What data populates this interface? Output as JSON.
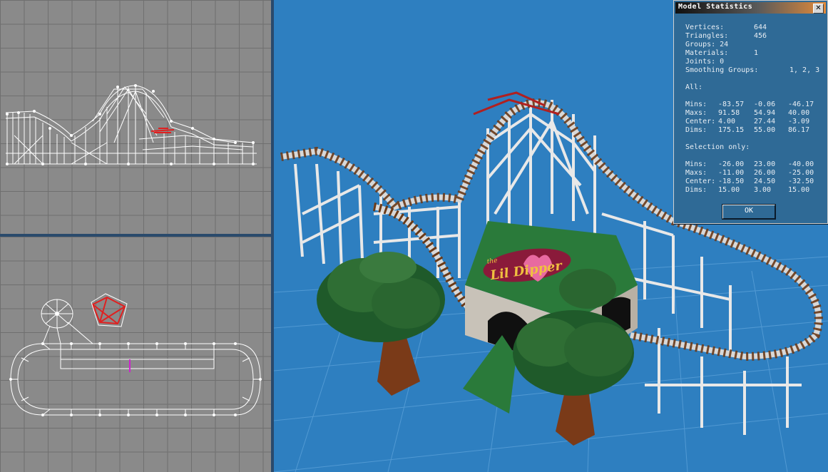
{
  "viewports": {
    "side": {
      "name": "side-view"
    },
    "top": {
      "name": "top-view"
    },
    "perspective": {
      "sign_text": "Lil Dipper",
      "sign_prefix": "the"
    }
  },
  "dialog": {
    "title": "Model Statistics",
    "close_label": "✕",
    "ok_label": "OK",
    "counts": [
      {
        "label": "Vertices:",
        "value": "644"
      },
      {
        "label": "Triangles:",
        "value": "456"
      },
      {
        "label": "Groups: 24",
        "value": ""
      },
      {
        "label": "Materials:",
        "value": "1"
      },
      {
        "label": "Joints: 0",
        "value": ""
      },
      {
        "label": "Smoothing Groups:",
        "value": "1, 2, 3"
      }
    ],
    "all_heading": "All:",
    "all_rows": [
      {
        "label": "Mins:",
        "x": "-83.57",
        "y": "-0.06",
        "z": "-46.17"
      },
      {
        "label": "Maxs:",
        "x": "91.58",
        "y": "54.94",
        "z": "40.00"
      },
      {
        "label": "Center:",
        "x": "4.00",
        "y": "27.44",
        "z": "-3.09"
      },
      {
        "label": "Dims:",
        "x": "175.15",
        "y": "55.00",
        "z": "86.17"
      }
    ],
    "sel_heading": "Selection only:",
    "sel_rows": [
      {
        "label": "Mins:",
        "x": "-26.00",
        "y": "23.00",
        "z": "-40.00"
      },
      {
        "label": "Maxs:",
        "x": "-11.00",
        "y": "26.00",
        "z": "-25.00"
      },
      {
        "label": "Center:",
        "x": "-18.50",
        "y": "24.50",
        "z": "-32.50"
      },
      {
        "label": "Dims:",
        "x": "15.00",
        "y": "3.00",
        "z": "15.00"
      }
    ]
  },
  "colors": {
    "viewport_bg": "#8a8a8a",
    "sky": "#2e7fc0",
    "selection": "#e02020",
    "wire": "#ffffff"
  }
}
